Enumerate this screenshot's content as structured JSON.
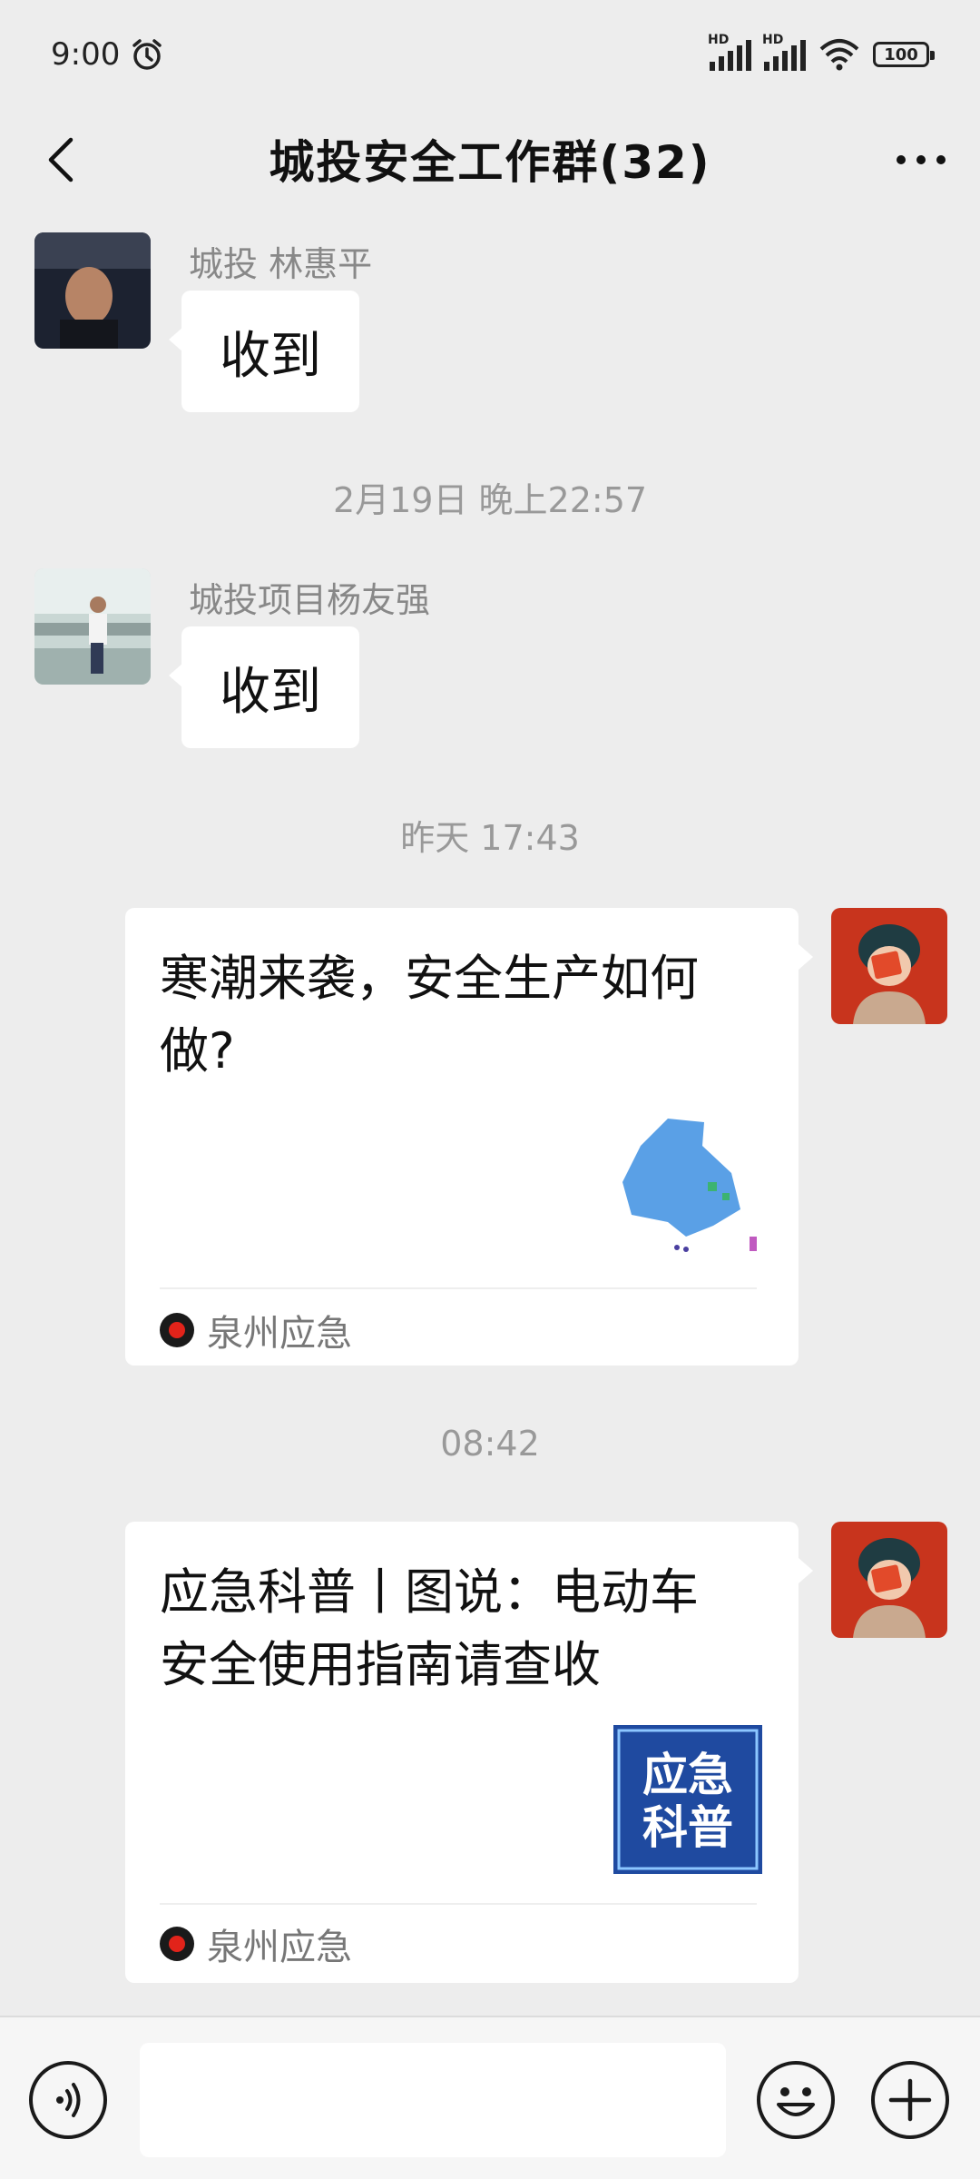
{
  "status": {
    "time": "9:00",
    "hd1": "HD",
    "hd2": "HD",
    "battery": "100"
  },
  "nav": {
    "title": "城投安全工作群(32)"
  },
  "messages": [
    {
      "sender": "城投 林惠平",
      "text": "收到"
    },
    {
      "sender": "城投项目杨友强",
      "text": "收到"
    }
  ],
  "time_labels": [
    "2月19日 晚上22:57",
    "昨天 17:43",
    "08:42"
  ],
  "cards": [
    {
      "title": "寒潮来袭，安全生产如何做?",
      "source": "泉州应急"
    },
    {
      "title": "应急科普丨图说：电动车安全使用指南请查收",
      "source": "泉州应急",
      "thumb_text_1": "应急",
      "thumb_text_2": "科普"
    }
  ],
  "colors": {
    "background": "#ededed",
    "bubble": "#ffffff",
    "avatar_self": "#c8341d",
    "map_blue": "#5aa0e6",
    "thumb_blue": "#1f4aa0"
  }
}
